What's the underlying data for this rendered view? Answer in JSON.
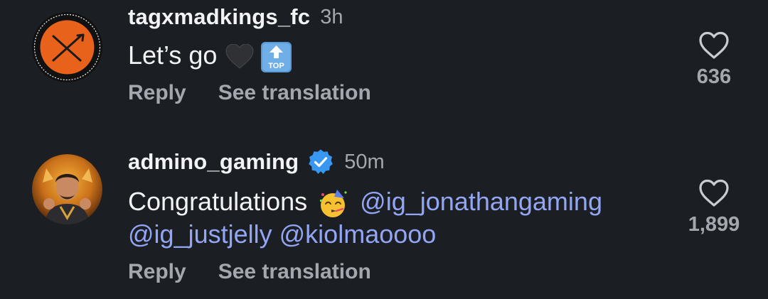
{
  "comments": [
    {
      "username": "tagxmadkings_fc",
      "time": "3h",
      "verified": false,
      "text_line1": "Let’s go",
      "emojis": [
        "black-heart",
        "top-arrow"
      ],
      "top_label": "TOP",
      "reply_label": "Reply",
      "translate_label": "See translation",
      "likes": "636"
    },
    {
      "username": "admino_gaming",
      "time": "50m",
      "verified": true,
      "text_intro": "Congratulations",
      "mention1": "@ig_jonathangaming",
      "mention2": "@ig_justjelly",
      "mention3": "@kiolmaoooo",
      "emojis": [
        "partying-face"
      ],
      "reply_label": "Reply",
      "translate_label": "See translation",
      "likes": "1,899"
    }
  ],
  "colors": {
    "background": "#1b1e22",
    "mention": "#93a6f5",
    "secondary_text": "#a4a8ae",
    "verified_badge": "#3897f0"
  }
}
